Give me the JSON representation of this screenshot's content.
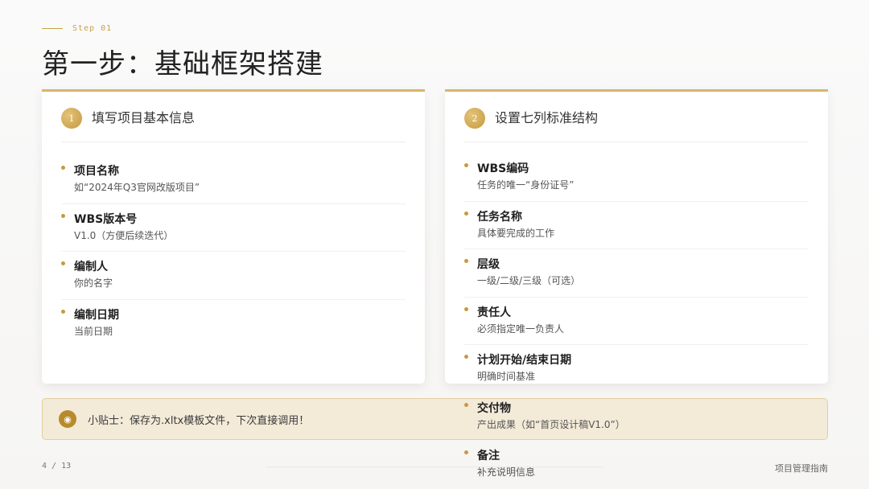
{
  "header": {
    "step_label": "Step 01",
    "title": "第一步：基础框架搭建"
  },
  "cards": [
    {
      "number": "1",
      "title": "填写项目基本信息",
      "items": [
        {
          "title": "项目名称",
          "desc": "如“2024年Q3官网改版项目”"
        },
        {
          "title": "WBS版本号",
          "desc": "V1.0（方便后续迭代）"
        },
        {
          "title": "编制人",
          "desc": "你的名字"
        },
        {
          "title": "编制日期",
          "desc": "当前日期"
        }
      ]
    },
    {
      "number": "2",
      "title": "设置七列标准结构",
      "items": [
        {
          "title": "WBS编码",
          "desc": "任务的唯一“身份证号”"
        },
        {
          "title": "任务名称",
          "desc": "具体要完成的工作"
        },
        {
          "title": "层级",
          "desc": "一级/二级/三级（可选）"
        },
        {
          "title": "责任人",
          "desc": "必须指定唯一负责人"
        },
        {
          "title": "计划开始/结束日期",
          "desc": "明确时间基准"
        },
        {
          "title": "交付物",
          "desc": "产出成果（如“首页设计稿V1.0”）"
        },
        {
          "title": "备注",
          "desc": "补充说明信息"
        }
      ]
    }
  ],
  "tip": {
    "icon_glyph": "◉",
    "text": "小贴士：保存为.xltx模板文件，下次直接调用！"
  },
  "footer": {
    "page": "4 / 13",
    "brand": "项目管理指南"
  },
  "colors": {
    "accent_gold": "#c7a14a",
    "tip_background": "#f3ead8"
  }
}
